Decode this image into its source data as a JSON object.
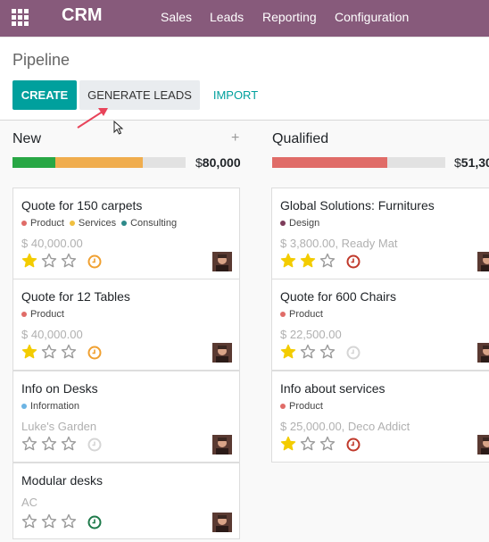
{
  "navbar": {
    "brand": "CRM",
    "menu": [
      "Sales",
      "Leads",
      "Reporting",
      "Configuration"
    ]
  },
  "control_panel": {
    "breadcrumb": "Pipeline",
    "create_label": "CREATE",
    "generate_label": "GENERATE LEADS",
    "import_label": "IMPORT"
  },
  "columns": [
    {
      "title": "New",
      "total_currency": "$",
      "total_value": "80,000",
      "cards": [
        {
          "title": "Quote for 150 carpets",
          "tags": [
            "Product",
            "Services",
            "Consulting"
          ],
          "subtitle": "$ 40,000.00",
          "stars": 1,
          "activity": "overdue"
        },
        {
          "title": "Quote for 12 Tables",
          "tags": [
            "Product"
          ],
          "subtitle": "$ 40,000.00",
          "stars": 1,
          "activity": "overdue"
        },
        {
          "title": "Info on Desks",
          "tags": [
            "Information"
          ],
          "subtitle": "Luke's Garden",
          "stars": 0,
          "activity": "none"
        },
        {
          "title": "Modular desks",
          "tags": [],
          "subtitle": "AC",
          "stars": 0,
          "activity": "planned"
        }
      ]
    },
    {
      "title": "Qualified",
      "total_currency": "$",
      "total_value": "51,30",
      "cards": [
        {
          "title": "Global Solutions: Furnitures",
          "tags": [
            "Design"
          ],
          "subtitle": "$ 3,800.00, Ready Mat",
          "stars": 2,
          "activity": "late"
        },
        {
          "title": "Quote for 600 Chairs",
          "tags": [
            "Product"
          ],
          "subtitle": "$ 22,500.00",
          "stars": 1,
          "activity": "none"
        },
        {
          "title": "Info about services",
          "tags": [
            "Product"
          ],
          "subtitle": "$ 25,000.00, Deco Addict",
          "stars": 1,
          "activity": "late"
        }
      ]
    }
  ],
  "colors": {
    "navbar": "#875a7b",
    "primary": "#00a09d",
    "progress_green": "#28a745",
    "progress_orange": "#f0ad4e",
    "progress_red": "#e06c68",
    "progress_grey": "#e2e2e2",
    "star_yellow": "#f3cc00",
    "tag_product": "#e06c68",
    "tag_services": "#f0c040",
    "tag_consulting": "#2e8a8a",
    "tag_information": "#6cb4e4",
    "tag_design": "#7d3c5a"
  },
  "icons": {
    "apps": "apps-grid-icon",
    "star_filled": "star-filled-icon",
    "star_empty": "star-empty-icon",
    "clock": "clock-icon",
    "plus": "plus-icon",
    "avatar": "avatar-icon"
  }
}
